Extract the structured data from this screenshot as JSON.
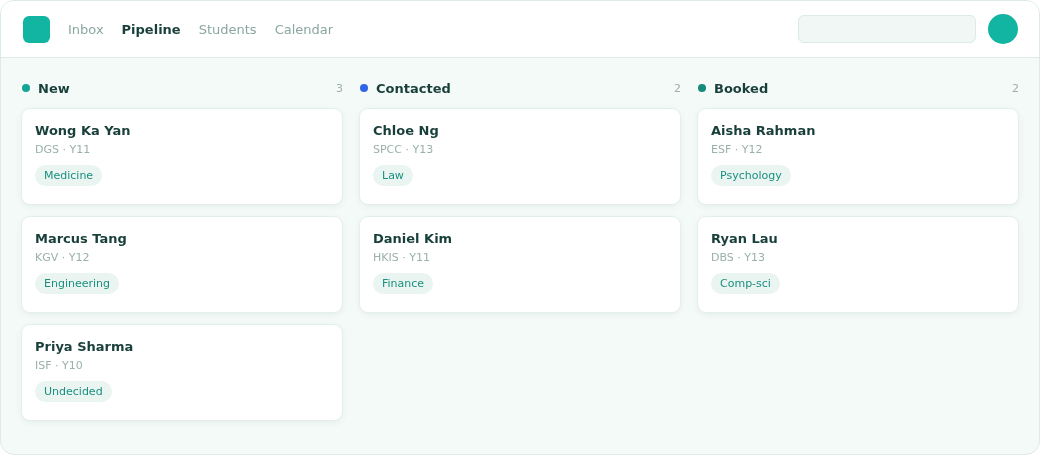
{
  "nav": [
    {
      "label": "Inbox",
      "selected": false
    },
    {
      "label": "Pipeline",
      "selected": true
    },
    {
      "label": "Students",
      "selected": false
    },
    {
      "label": "Calendar",
      "selected": false
    }
  ],
  "columns": [
    {
      "title": "New",
      "count": "3",
      "color": "#14a596",
      "cards": [
        {
          "name": "Wong Ka Yan",
          "meta": "DGS · Y11",
          "tag": "Medicine"
        },
        {
          "name": "Marcus Tang",
          "meta": "KGV · Y12",
          "tag": "Engineering"
        },
        {
          "name": "Priya Sharma",
          "meta": "ISF · Y10",
          "tag": "Undecided"
        }
      ]
    },
    {
      "title": "Contacted",
      "count": "2",
      "color": "#2f64e6",
      "cards": [
        {
          "name": "Chloe Ng",
          "meta": "SPCC · Y13",
          "tag": "Law"
        },
        {
          "name": "Daniel Kim",
          "meta": "HKIS · Y11",
          "tag": "Finance"
        }
      ]
    },
    {
      "title": "Booked",
      "count": "2",
      "color": "#168a7c",
      "cards": [
        {
          "name": "Aisha Rahman",
          "meta": "ESF · Y12",
          "tag": "Psychology"
        },
        {
          "name": "Ryan Lau",
          "meta": "DBS · Y13",
          "tag": "Comp-sci"
        }
      ]
    }
  ]
}
